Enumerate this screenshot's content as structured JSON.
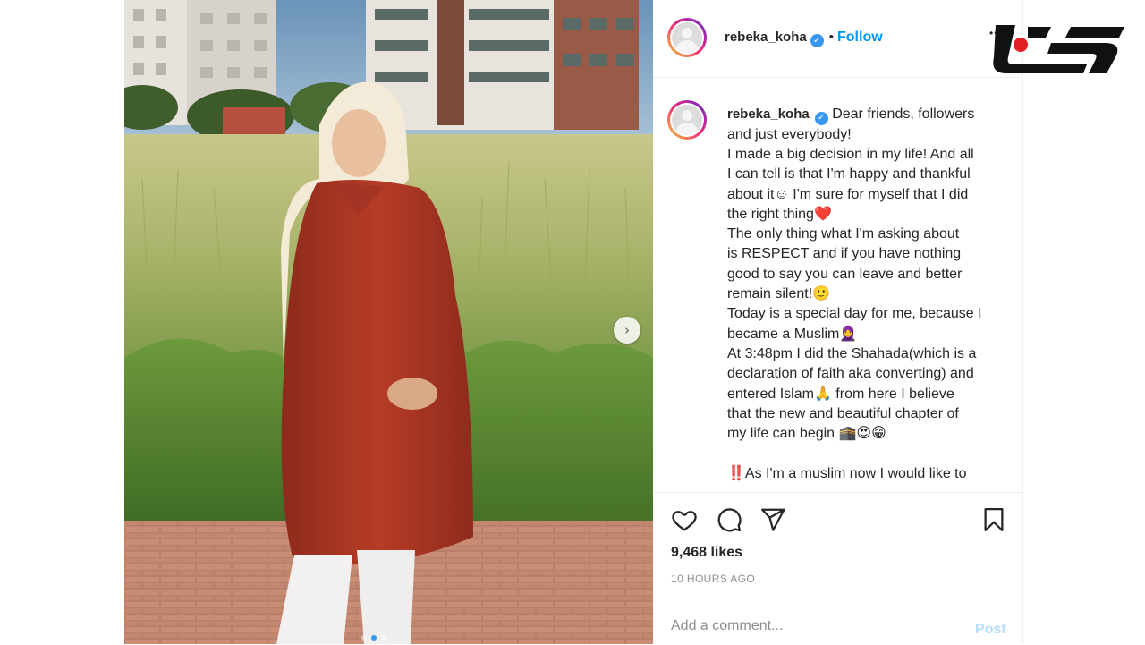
{
  "post": {
    "username": "rebeka_koha",
    "follow_label": "Follow",
    "more_label": "•••",
    "verified_mark": "✓",
    "caption_lines": [
      "Dear friends, followers",
      "and just everybody!",
      "I made a big decision in my life! And all",
      "I can tell is that I'm happy and thankful",
      "about it☺ I'm sure for myself that I did",
      "the right thing❤️",
      "The only thing what I'm asking about",
      "is RESPECT and if you have nothing",
      "good to say you can leave and better",
      "remain silent!🙂",
      "Today is a special day for me, because I",
      "became a Muslim🧕",
      "At 3:48pm I did the Shahada(which is a",
      "declaration of faith aka converting) and",
      "entered Islam🙏 from here I believe",
      "that the new and beautiful chapter of",
      "my life can begin 🕋😍😁",
      "",
      "‼️As I'm a muslim now I would like to"
    ],
    "likes": "9,468 likes",
    "time_ago": "10 HOURS AGO",
    "comment_placeholder": "Add a comment...",
    "post_label": "Post",
    "carousel_next": "›",
    "carousel_current_index": 2,
    "carousel_count": 3
  },
  "icons": {
    "like": "heart-icon",
    "comment": "comment-icon",
    "share": "send-icon",
    "save": "bookmark-icon",
    "more": "more-icon"
  },
  "colors": {
    "link_blue": "#0095f6",
    "verified_blue": "#3897f0",
    "post_disabled": "#b2dffc",
    "logo_red": "#e31e24"
  }
}
